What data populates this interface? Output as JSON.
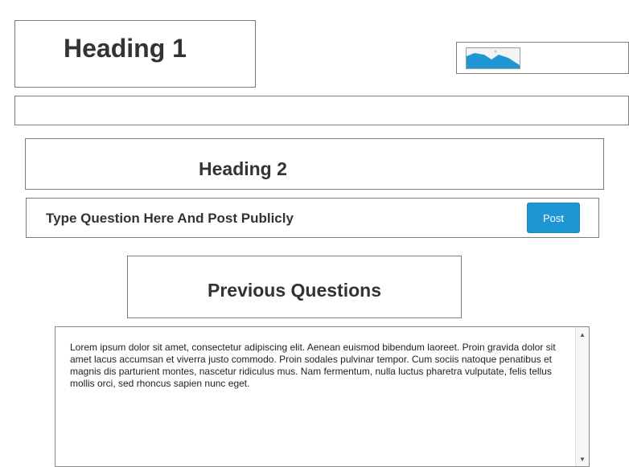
{
  "header": {
    "heading1": "Heading 1",
    "image_placeholder_icon": "image-icon"
  },
  "section": {
    "heading2": "Heading 2"
  },
  "question_bar": {
    "prompt": "Type Question Here And Post Publicly",
    "post_label": "Post",
    "post_color": "#1e96d4"
  },
  "previous": {
    "title": "Previous Questions"
  },
  "textarea": {
    "text": "Lorem ipsum dolor sit amet, consectetur adipiscing elit. Aenean euismod bibendum laoreet. Proin gravida dolor sit amet lacus accumsan et viverra justo commodo. Proin sodales pulvinar tempor. Cum sociis natoque penatibus et magnis dis parturient montes, nascetur ridiculus mus. Nam fermentum, nulla luctus pharetra vulputate, felis tellus mollis orci, sed rhoncus sapien nunc eget."
  }
}
